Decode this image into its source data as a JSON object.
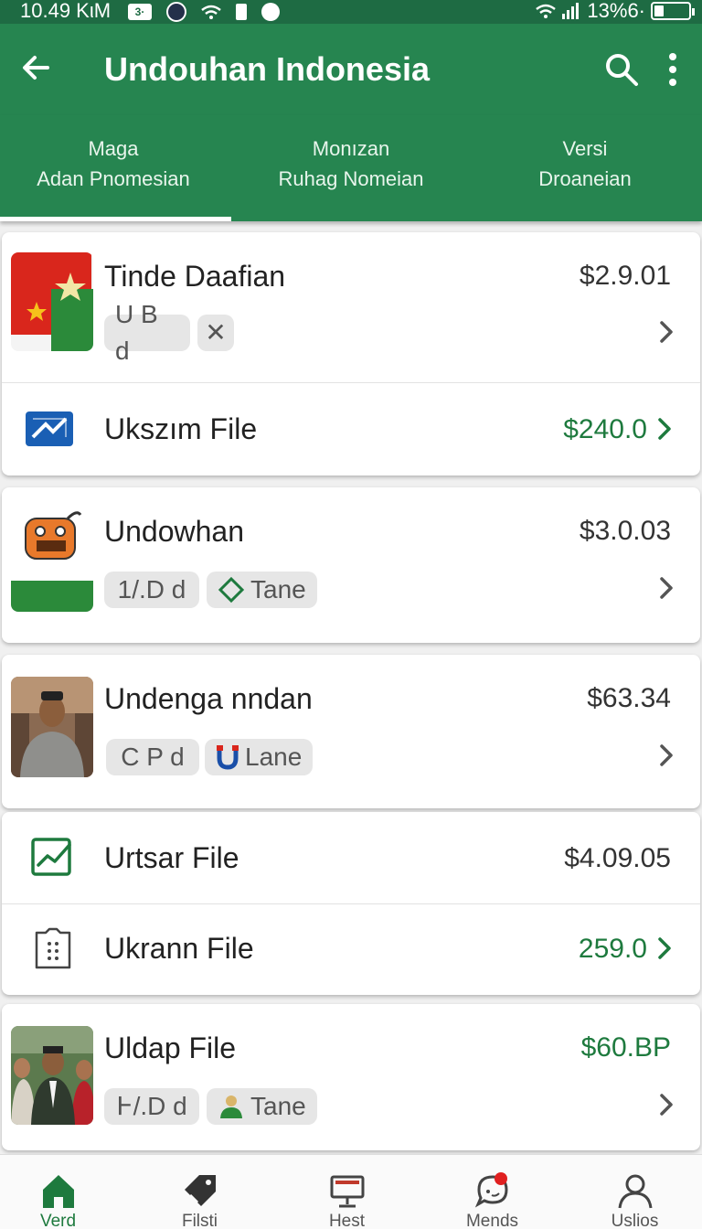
{
  "status_bar": {
    "time": "10.49 KιM",
    "box_label": "3·",
    "battery_text": "13%6·"
  },
  "app_bar": {
    "title": "Undouhan Indonesia"
  },
  "tabs": [
    {
      "line1": "Maga",
      "line2": "Adan Pnomesian",
      "active": true
    },
    {
      "line1": "Monızan",
      "line2": "Ruhag Nomeian",
      "active": false
    },
    {
      "line1": "Versi",
      "line2": "Droaneian",
      "active": false
    }
  ],
  "items": [
    {
      "name": "Tinde Daafian",
      "price": "$2.9.01",
      "chips": [
        "U B d",
        "✕"
      ],
      "icon": "flag-icon"
    },
    {
      "name": "Ukszım File",
      "price": "$240.0",
      "icon": "mail-icon"
    },
    {
      "name": "Undowhan",
      "price": "$3.0.03",
      "chips": [
        "1/.D d",
        "Tane"
      ],
      "icon": "robot-icon"
    },
    {
      "name": "Undenga nndan",
      "price": "$63.34",
      "chips": [
        "C P d",
        "Lane"
      ],
      "icon": "person-photo"
    },
    {
      "name": "Urtsar File",
      "price": "$4.09.05",
      "icon": "chart-icon"
    },
    {
      "name": "Ukrann File",
      "price": "259.0",
      "icon": "phone-icon"
    },
    {
      "name": "Uldap File",
      "price": "$60.BP",
      "chips": [
        "Ͱ/.D d",
        "Tane"
      ],
      "icon": "group-photo"
    }
  ],
  "bottom_nav": [
    {
      "label": "Verd",
      "icon": "home-icon",
      "active": true
    },
    {
      "label": "Filsti",
      "icon": "tag-icon",
      "active": false
    },
    {
      "label": "Hest",
      "icon": "monitor-icon",
      "active": false
    },
    {
      "label": "Mends",
      "icon": "chat-icon",
      "active": false
    },
    {
      "label": "Uslios",
      "icon": "user-icon",
      "active": false
    }
  ],
  "colors": {
    "primary": "#268550",
    "status": "#1e6b43",
    "price_green": "#1e7a3e"
  }
}
